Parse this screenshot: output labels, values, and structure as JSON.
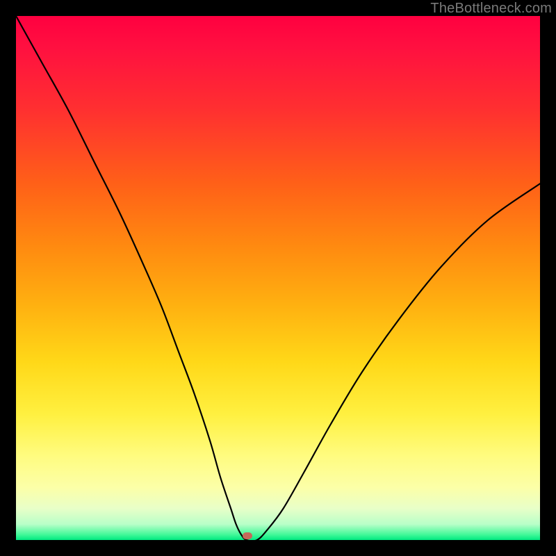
{
  "watermark": "TheBottleneck.com",
  "marker": {
    "x_pct": 44.2,
    "y_pct": 99.2
  },
  "chart_data": {
    "type": "line",
    "title": "",
    "xlabel": "",
    "ylabel": "",
    "xlim": [
      0,
      100
    ],
    "ylim": [
      0,
      100
    ],
    "x": [
      0,
      5,
      10,
      15,
      20,
      25,
      28,
      31,
      34,
      37,
      39,
      41,
      42,
      43,
      44,
      46,
      48,
      51,
      55,
      60,
      66,
      73,
      81,
      90,
      100
    ],
    "values": [
      100,
      91,
      82,
      72,
      62,
      51,
      44,
      36,
      28,
      19,
      12,
      6,
      3,
      1,
      0,
      0,
      2,
      6,
      13,
      22,
      32,
      42,
      52,
      61,
      68
    ],
    "annotations": []
  }
}
